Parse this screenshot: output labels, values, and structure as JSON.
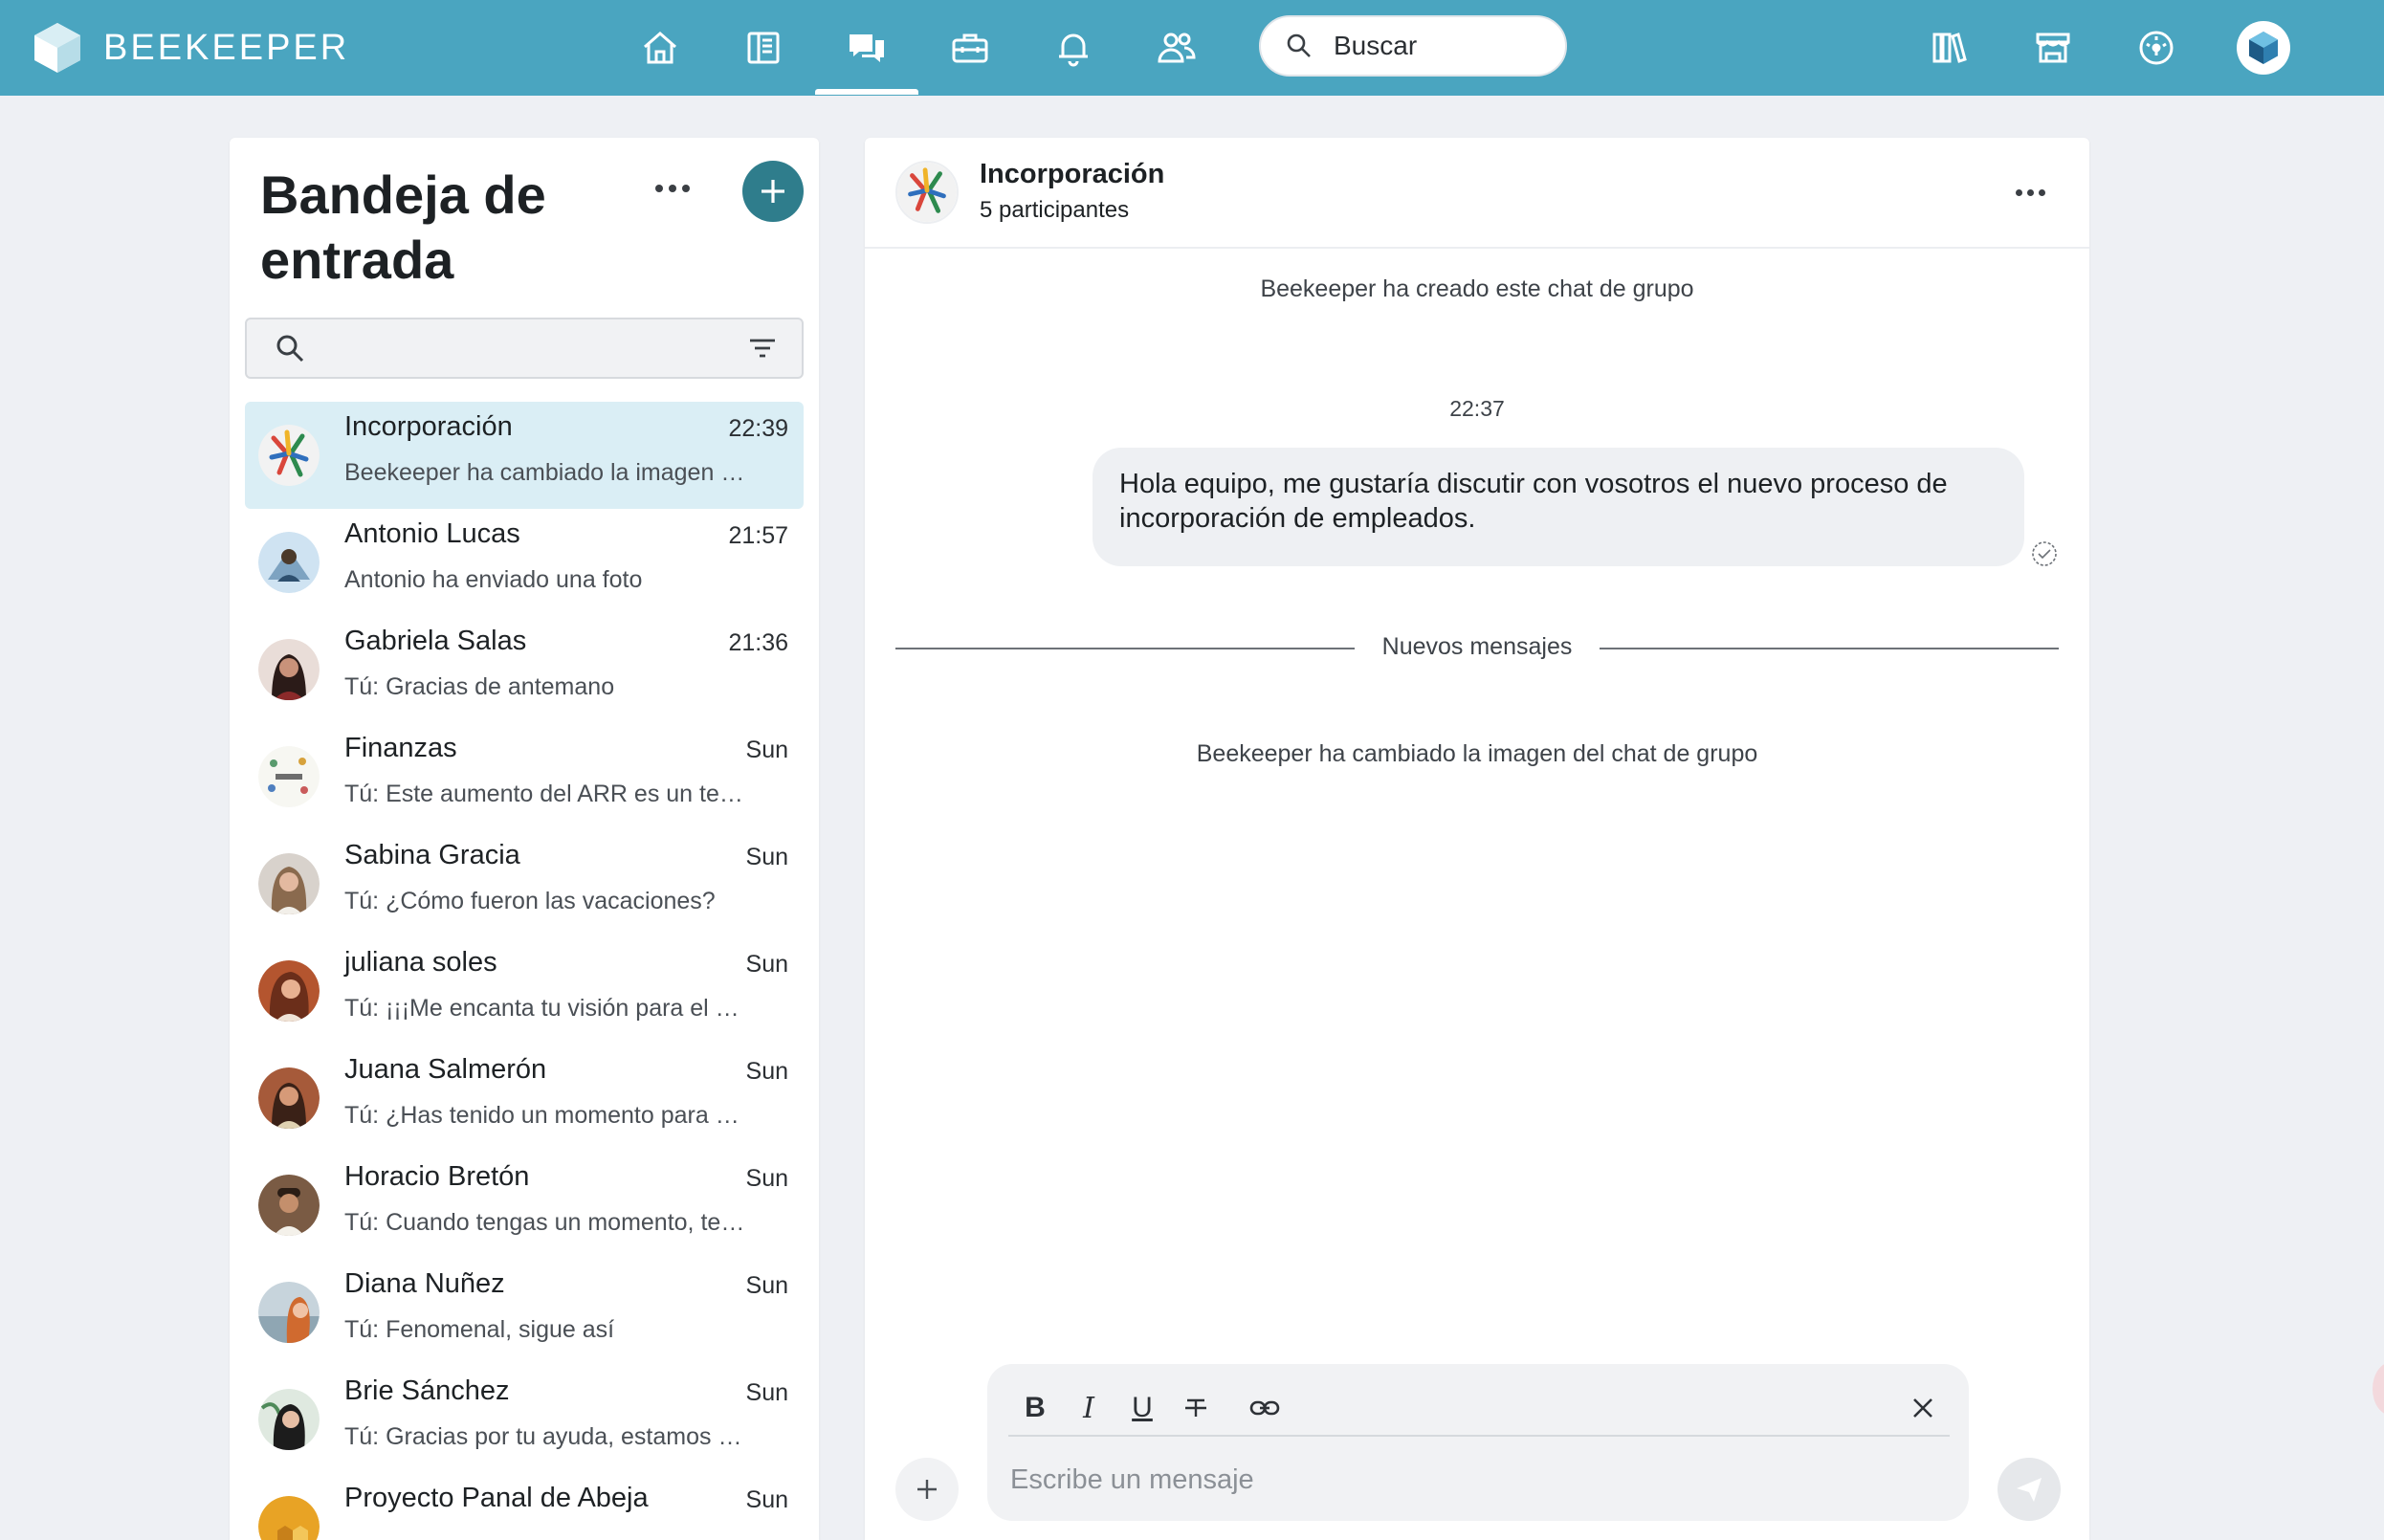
{
  "app": {
    "brand_name": "BEEKEEPER"
  },
  "topbar": {
    "nav": [
      {
        "name": "home-icon"
      },
      {
        "name": "streams-icon"
      },
      {
        "name": "chat-icon",
        "active": true
      },
      {
        "name": "toolbox-icon"
      },
      {
        "name": "bell-icon"
      },
      {
        "name": "people-icon"
      }
    ],
    "search_placeholder": "Buscar",
    "right_icons": [
      "library-icon",
      "store-icon",
      "dashboard-icon",
      "profile-avatar"
    ],
    "bg_color": "#4aa5c0"
  },
  "inbox": {
    "title": "Bandeja de entrada",
    "conversations": [
      {
        "name": "Incorporación",
        "time": "22:39",
        "preview": "Beekeeper ha cambiado la imagen del chat de grupo",
        "active": true,
        "avatar": "multicolor-figures"
      },
      {
        "name": "Antonio Lucas",
        "time": "21:57",
        "preview": "Antonio ha enviado una foto",
        "avatar": "photo"
      },
      {
        "name": "Gabriela Salas",
        "time": "21:36",
        "preview": "Tú: Gracias de antemano",
        "avatar": "photo"
      },
      {
        "name": "Finanzas",
        "time": "Sun",
        "preview": "Tú: Este aumento del ARR es un testimonio",
        "avatar": "finanzas"
      },
      {
        "name": "Sabina Gracia",
        "time": "Sun",
        "preview": "Tú: ¿Cómo fueron las vacaciones?",
        "avatar": "photo"
      },
      {
        "name": "juliana soles",
        "time": "Sun",
        "preview": "Tú: ¡¡¡Me encanta tu visión para el proyecto",
        "avatar": "photo"
      },
      {
        "name": "Juana Salmerón",
        "time": "Sun",
        "preview": "Tú: ¿Has tenido un momento para revisar",
        "avatar": "photo"
      },
      {
        "name": "Horacio Bretón",
        "time": "Sun",
        "preview": "Tú: Cuando tengas un momento, te agradecería",
        "avatar": "photo"
      },
      {
        "name": "Diana Nuñez",
        "time": "Sun",
        "preview": "Tú: Fenomenal, sigue así",
        "avatar": "photo"
      },
      {
        "name": "Brie Sánchez",
        "time": "Sun",
        "preview": "Tú: Gracias por tu ayuda, estamos en ello",
        "avatar": "photo"
      },
      {
        "name": "Proyecto Panal de Abeja",
        "time": "Sun",
        "preview": "",
        "avatar": "honeycomb"
      }
    ]
  },
  "chat": {
    "title": "Incorporación",
    "participants": "5 participantes",
    "system_created": "Beekeeper ha creado este chat de grupo",
    "time_label": "22:37",
    "message": "Hola equipo, me gustaría discutir con vosotros el nuevo proceso de incorporación de empleados.",
    "new_messages_label": "Nuevos mensajes",
    "system_changed": "Beekeeper ha cambiado la imagen del chat de grupo",
    "composer": {
      "placeholder": "Escribe un mensaje",
      "format_buttons": [
        "B",
        "I",
        "U",
        "S",
        "link"
      ]
    }
  }
}
